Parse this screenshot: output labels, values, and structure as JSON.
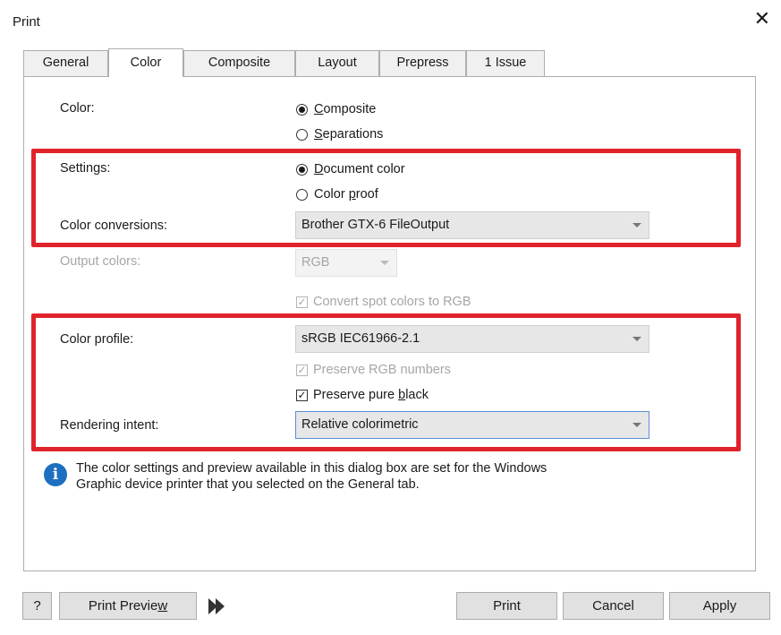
{
  "window": {
    "title": "Print",
    "close_glyph": "✕"
  },
  "tabs": [
    {
      "label": "General"
    },
    {
      "label": "Color"
    },
    {
      "label": "Composite"
    },
    {
      "label": "Layout"
    },
    {
      "label": "Prepress"
    },
    {
      "label": "1 Issue"
    }
  ],
  "active_tab": "Color",
  "color": {
    "label": "Color:",
    "options": [
      {
        "prefix": "",
        "hotkey": "C",
        "rest": "omposite",
        "selected": true
      },
      {
        "prefix": "",
        "hotkey": "S",
        "rest": "eparations",
        "selected": false
      }
    ]
  },
  "settings": {
    "label": "Settings:",
    "options": [
      {
        "prefix": "",
        "hotkey": "D",
        "rest": "ocument color",
        "selected": true
      },
      {
        "prefix": "Color ",
        "hotkey": "p",
        "rest": "roof",
        "selected": false
      }
    ]
  },
  "color_conversions": {
    "label": "Color conversions:",
    "value": "Brother GTX-6  FileOutput"
  },
  "output_colors": {
    "label": "Output colors:",
    "value": "RGB",
    "disabled": true
  },
  "convert_spot": {
    "check_glyph": "✓",
    "label": "Convert spot colors to RGB",
    "checked": true,
    "disabled": true
  },
  "color_profile": {
    "label": "Color profile:",
    "value": "sRGB IEC61966-2.1"
  },
  "preserve_rgb": {
    "check_glyph": "✓",
    "label": "Preserve RGB numbers",
    "checked": true,
    "disabled": true
  },
  "preserve_black": {
    "check_glyph": "✓",
    "prefix": "Preserve pure ",
    "hotkey": "b",
    "rest": "lack",
    "checked": true,
    "disabled": false
  },
  "rendering_intent": {
    "label": "Rendering intent:",
    "value": "Relative colorimetric"
  },
  "info": {
    "icon": "i",
    "line1": "The color settings and preview available in this dialog box are set for the Windows",
    "line2": "Graphic device printer that you selected on the General tab."
  },
  "buttons": {
    "help": "?",
    "print_preview_prefix": "Print Previe",
    "print_preview_hotkey": "w",
    "print": "Print",
    "cancel": "Cancel",
    "apply": "Apply"
  },
  "colors": {
    "highlight": "#e0232b",
    "info_icon": "#1f6fc0",
    "focus_border": "#5b8fd6"
  }
}
